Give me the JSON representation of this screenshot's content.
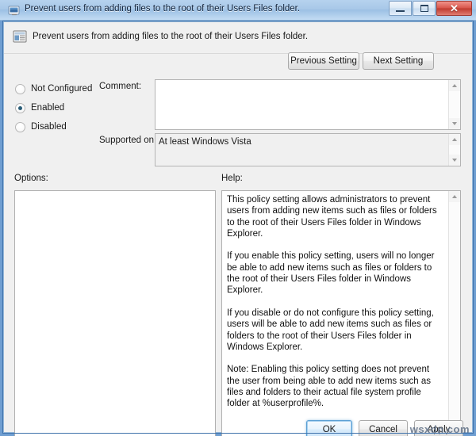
{
  "window": {
    "title": "Prevent users from adding files to the root of their Users Files folder.",
    "title_icon": "policy-shortcut-icon",
    "controls": {
      "minimize": "minimize-icon",
      "maximize": "maximize-icon",
      "close_label": "✕"
    }
  },
  "header": {
    "icon": "policy-setting-icon",
    "policy_name": "Prevent users from adding files to the root of their Users Files folder.",
    "previous_setting_label": "Previous Setting",
    "next_setting_label": "Next Setting"
  },
  "state": {
    "options": [
      {
        "label": "Not Configured",
        "selected": false
      },
      {
        "label": "Enabled",
        "selected": true
      },
      {
        "label": "Disabled",
        "selected": false
      }
    ],
    "selected_state": "Enabled"
  },
  "comment": {
    "label": "Comment:",
    "value": "",
    "placeholder": ""
  },
  "supported_on": {
    "label": "Supported on:",
    "value": "At least Windows Vista"
  },
  "options_section": {
    "label": "Options:",
    "content": ""
  },
  "help_section": {
    "label": "Help:",
    "text": "This policy setting allows administrators to prevent users from adding new items such as files or folders to the root of their Users Files folder in Windows Explorer.\n\nIf you enable this policy setting, users will no longer be able to add new items such as files or folders to the root of their Users Files folder in Windows Explorer.\n\nIf you disable or do not configure this policy setting, users will be able to add new items such as files or folders to the root of their Users Files folder in Windows Explorer.\n\nNote: Enabling this policy setting does not prevent the user from being able to add new items such as files and folders to their actual file system profile folder at %userprofile%."
  },
  "footer": {
    "ok_label": "OK",
    "cancel_label": "Cancel",
    "apply_label": "Apply"
  },
  "watermark": "wsxdn.com",
  "colors": {
    "frame": "#6f9ed1",
    "title_gradient_top": "#b6d2ee",
    "close_button": "#c0392b",
    "radio_dot": "#2a5d77",
    "focus_ring": "#5a9fd4",
    "client_background": "#f0f0f0"
  }
}
